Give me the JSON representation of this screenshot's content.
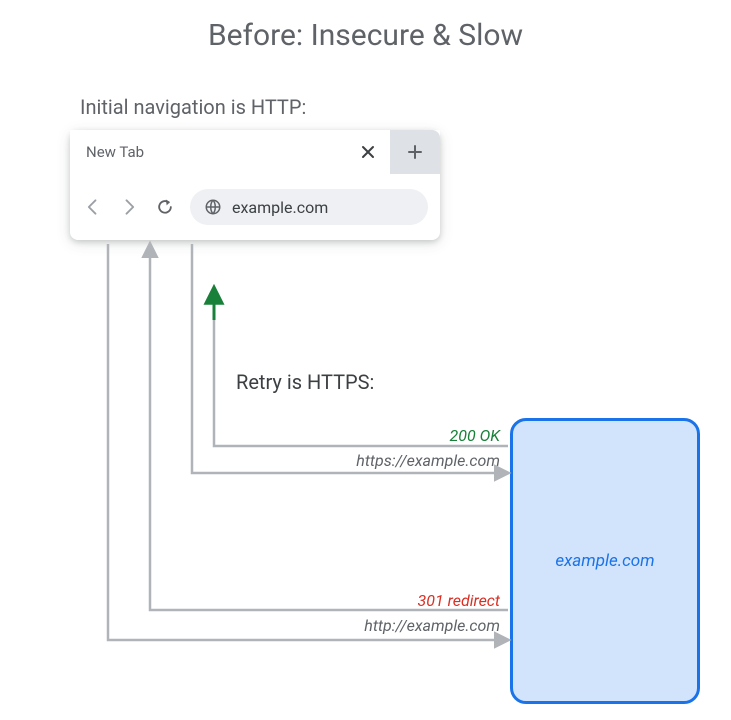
{
  "title": "Before: Insecure & Slow",
  "subtitle": "Initial navigation is HTTP:",
  "retry_text": "Retry is HTTPS:",
  "browser": {
    "tab_label": "New Tab",
    "omnibox": "example.com"
  },
  "server_label": "example.com",
  "flows": {
    "request1": {
      "url": "http://example.com",
      "status": "301 redirect"
    },
    "request2": {
      "url": "https://example.com",
      "status": "200 OK"
    }
  },
  "colors": {
    "accent_blue": "#1a73e8",
    "accent_green": "#188038",
    "accent_red": "#d93025",
    "gray": "#b0b4b9"
  }
}
